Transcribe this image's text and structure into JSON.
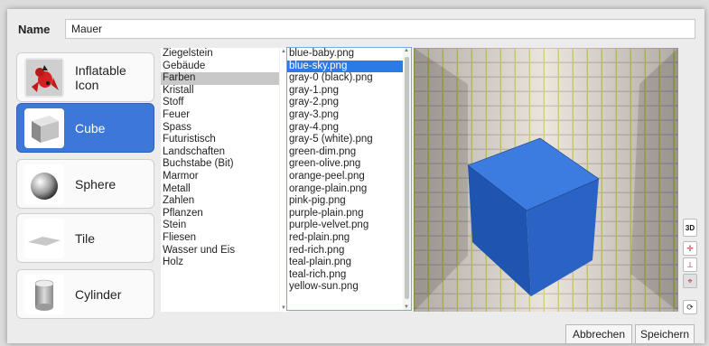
{
  "name": {
    "label": "Name",
    "value": "Mauer"
  },
  "shapes": [
    {
      "label": "Inflatable Icon",
      "icon": "inflatable-icon",
      "selected": false
    },
    {
      "label": "Cube",
      "icon": "cube-icon",
      "selected": true
    },
    {
      "label": "Sphere",
      "icon": "sphere-icon",
      "selected": false
    },
    {
      "label": "Tile",
      "icon": "tile-icon",
      "selected": false
    },
    {
      "label": "Cylinder",
      "icon": "cylinder-icon",
      "selected": false
    }
  ],
  "categories": [
    "Ziegelstein",
    "Gebäude",
    "Farben",
    "Kristall",
    "Stoff",
    "Feuer",
    "Spass",
    "Futuristisch",
    "Landschaften",
    "Buchstabe (Bit)",
    "Marmor",
    "Metall",
    "Zahlen",
    "Pflanzen",
    "Stein",
    "Fliesen",
    "Wasser und Eis",
    "Holz"
  ],
  "selected_category": "Farben",
  "files": [
    "blue-baby.png",
    "blue-sky.png",
    "gray-0 (black).png",
    "gray-1.png",
    "gray-2.png",
    "gray-3.png",
    "gray-4.png",
    "gray-5 (white).png",
    "green-dim.png",
    "green-olive.png",
    "orange-peel.png",
    "orange-plain.png",
    "pink-pig.png",
    "purple-plain.png",
    "purple-velvet.png",
    "red-plain.png",
    "red-rich.png",
    "teal-plain.png",
    "teal-rich.png",
    "yellow-sun.png"
  ],
  "selected_file": "blue-sky.png",
  "tools": {
    "view_3d": "3D"
  },
  "buttons": {
    "cancel": "Abbrechen",
    "save": "Speichern"
  },
  "colors": {
    "selection": "#3d78d8",
    "cube": "#2a63c4"
  }
}
